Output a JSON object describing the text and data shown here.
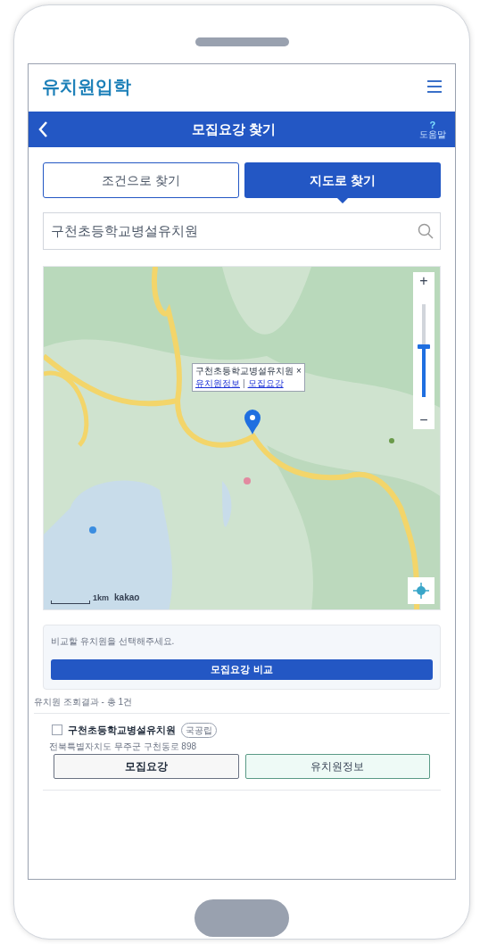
{
  "app": {
    "title": "유치원입학"
  },
  "title_bar": {
    "title": "모집요강 찾기",
    "help_icon": "?",
    "help_label": "도움말"
  },
  "tabs": [
    {
      "label": "조건으로 찾기",
      "selected": false
    },
    {
      "label": "지도로 찾기",
      "selected": true
    }
  ],
  "search": {
    "value": "구천초등학교병설유치원"
  },
  "map": {
    "zoom": {
      "plus": "+",
      "minus": "−",
      "level": 0.55
    },
    "popup": {
      "name": "구천초등학교병설유치원",
      "close": "×",
      "links": [
        "유치원정보",
        "모집요강"
      ],
      "separator": "|"
    },
    "scale": "1km",
    "attribution": "kakao"
  },
  "compare": {
    "hint": "비교할 유치원을 선택해주세요.",
    "button": "모집요강 비교"
  },
  "results": {
    "summary": "유치원 조회결과 - 총 1건",
    "items": [
      {
        "name": "구천초등학교병설유치원",
        "badge": "국공립",
        "address": "전북특별자치도 무주군 구천동로 898",
        "checked": false,
        "buttons": [
          {
            "label": "모집요강",
            "kind": "plain"
          },
          {
            "label": "유치원정보",
            "kind": "mint"
          }
        ]
      }
    ]
  }
}
